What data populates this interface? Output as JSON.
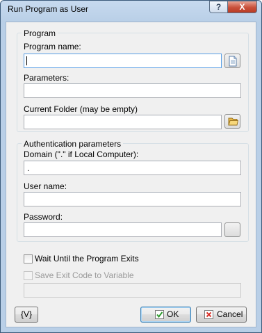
{
  "window": {
    "title": "Run Program as User",
    "help_glyph": "?",
    "close_glyph": "X"
  },
  "program_group": {
    "title": "Program",
    "program_name_label": "Program name:",
    "program_name_value": "",
    "parameters_label": "Parameters:",
    "parameters_value": "",
    "current_folder_label": "Current Folder (may be empty)",
    "current_folder_value": ""
  },
  "auth_group": {
    "title": "Authentication parameters",
    "domain_label": "Domain (\".\" if Local Computer):",
    "domain_value": ".",
    "user_name_label": "User name:",
    "user_name_value": "",
    "password_label": "Password:",
    "password_value": ""
  },
  "options": {
    "wait_label": "Wait Until the Program Exits",
    "wait_checked": false,
    "save_exit_label": "Save Exit Code to Variable",
    "save_exit_checked": false,
    "exit_variable_value": ""
  },
  "buttons": {
    "variables_label": "{V}",
    "ok_label": "OK",
    "cancel_label": "Cancel"
  },
  "icons": {
    "file_browse": "document-icon",
    "folder_browse": "folder-icon",
    "ok": "green-check-icon",
    "cancel": "red-x-icon"
  },
  "colors": {
    "titlebar": "#b9cfe7",
    "close_button": "#c9503a",
    "focus_border": "#569de5",
    "ok_check": "#2e9a2e",
    "cancel_x": "#d8322a"
  }
}
